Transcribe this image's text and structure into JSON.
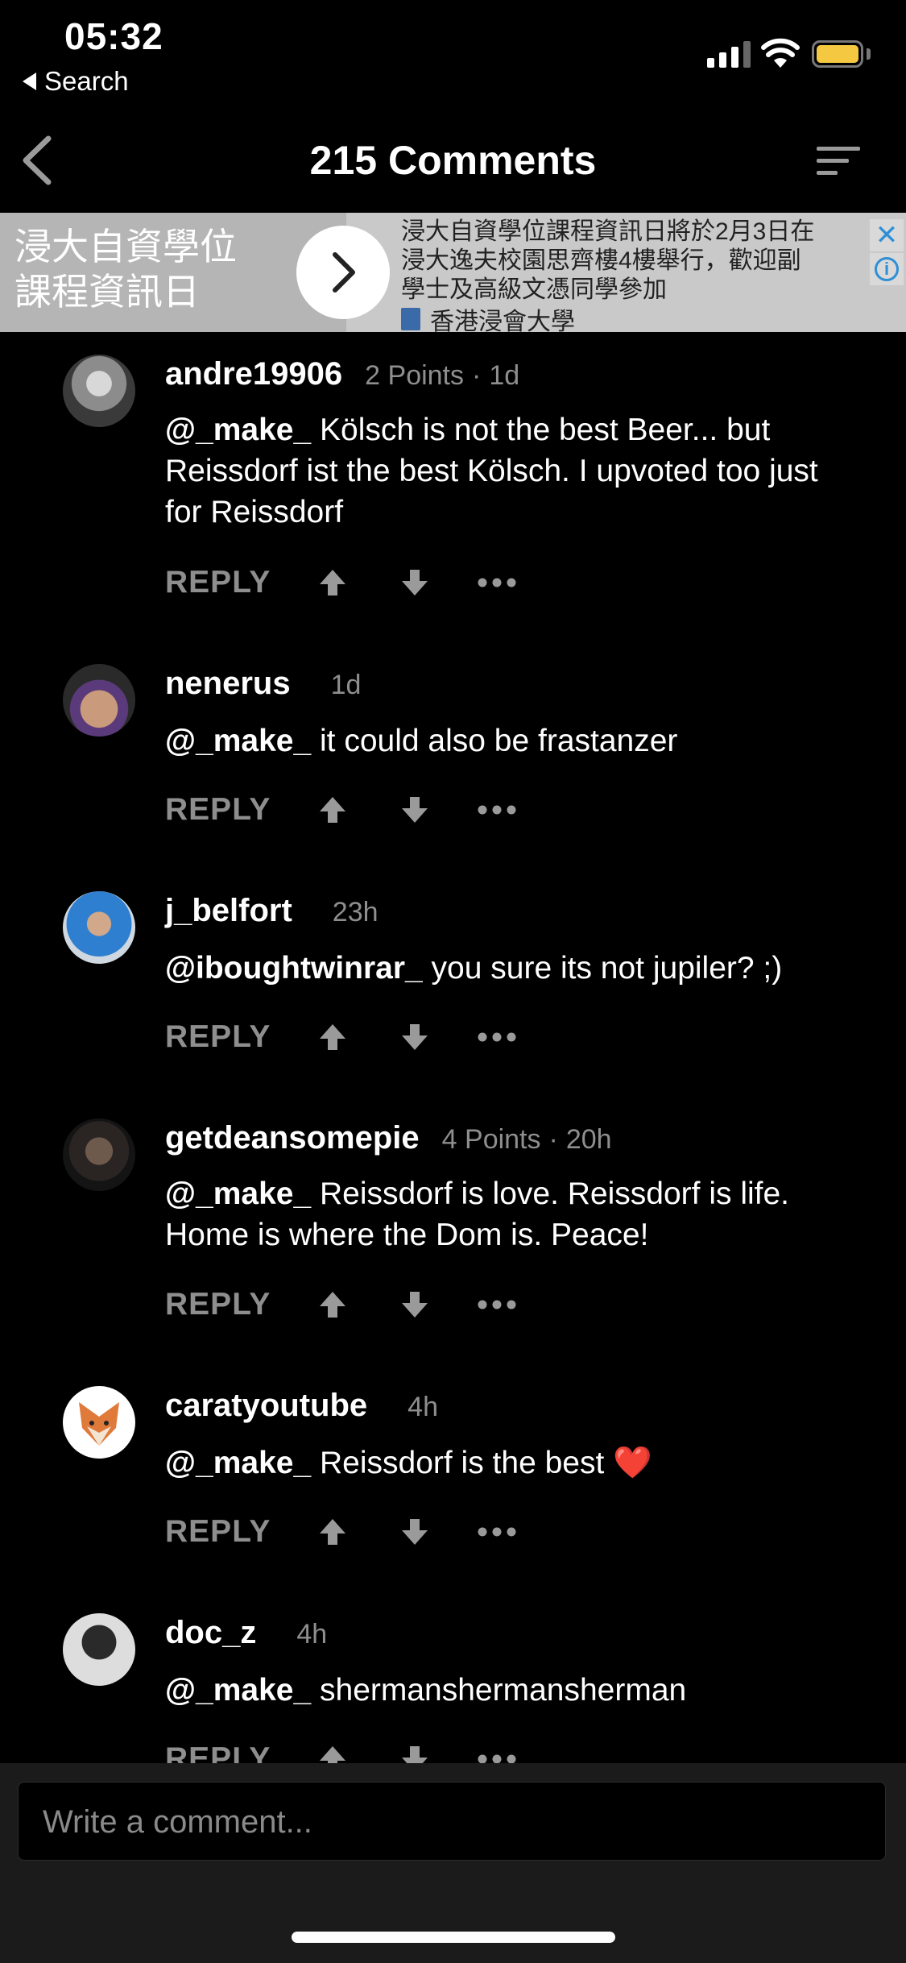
{
  "status_bar": {
    "time": "05:32",
    "back_app_label": "Search",
    "battery_color": "#f5c842"
  },
  "header": {
    "title": "215 Comments",
    "back_icon": "chevron-left-icon",
    "sort_icon": "sort-icon"
  },
  "ad": {
    "headline": "浸大自資學位課程資訊日",
    "description": "浸大自資學位課程資訊日將於2月3日在浸大逸夫校園思齊樓4樓舉行，歡迎副學士及高級文憑同學參加",
    "source": "香港浸會大學",
    "close_glyph": "✕",
    "info_glyph": "i"
  },
  "comments": [
    {
      "username": "andre19906",
      "points": "2 Points",
      "separator": "·",
      "age": "1d",
      "mention": "@_make_",
      "text": " Kölsch is not the best Beer... but Reissdorf ist the best Kölsch. I upvoted too just for Reissdorf",
      "reply_label": "REPLY"
    },
    {
      "username": "nenerus",
      "points": "",
      "age": "1d",
      "mention": "@_make_",
      "text": "it could also be frastanzer",
      "reply_label": "REPLY"
    },
    {
      "username": "j_belfort",
      "points": "",
      "age": "23h",
      "mention": "@iboughtwinrar_",
      "text": "you sure its not jupiler? ;)",
      "reply_label": "REPLY"
    },
    {
      "username": "getdeansomepie",
      "points": "4 Points",
      "separator": "·",
      "age": "20h",
      "mention": "@_make_",
      "text": "Reissdorf is love. Reissdorf is life. Home is where the Dom is. Peace!",
      "reply_label": "REPLY"
    },
    {
      "username": "caratyoutube",
      "points": "",
      "age": "4h",
      "mention": "@_make_",
      "text": "Reissdorf is the best ❤️",
      "reply_label": "REPLY"
    },
    {
      "username": "doc_z",
      "points": "",
      "age": "4h",
      "mention": "@_make_",
      "text": "shermanshermansherman",
      "reply_label": "REPLY"
    }
  ],
  "composer": {
    "placeholder": "Write a comment..."
  }
}
